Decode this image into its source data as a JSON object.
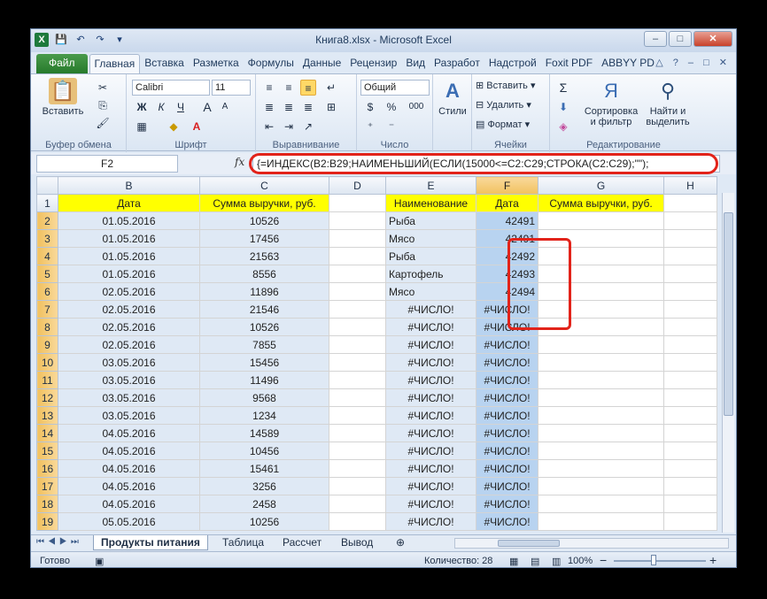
{
  "window": {
    "title": "Книга8.xlsx - Microsoft Excel",
    "min": "–",
    "max": "□",
    "close": "✕"
  },
  "qat": {
    "app_icon": "X",
    "save": "💾",
    "undo": "↶",
    "redo": "↷",
    "more": "▾"
  },
  "ribbon_tabs": [
    "Файл",
    "Главная",
    "Вставка",
    "Разметка",
    "Формулы",
    "Данные",
    "Рецензир",
    "Вид",
    "Разработ",
    "Надстрой",
    "Foxit PDF",
    "ABBYY PD"
  ],
  "ribbon": {
    "clipboard": {
      "paste": "Вставить",
      "label": "Буфер обмена"
    },
    "font": {
      "name": "Calibri",
      "size": "11",
      "bold": "Ж",
      "italic": "К",
      "underline": "Ч",
      "grow": "A",
      "shrink": "A",
      "label": "Шрифт"
    },
    "alignment": {
      "label": "Выравнивание"
    },
    "number": {
      "format": "Общий",
      "percent": "%",
      "thousands": "000",
      "label": "Число"
    },
    "styles": {
      "styles": "Стили"
    },
    "cells": {
      "insert": "Вставить",
      "delete": "Удалить",
      "format": "Формат",
      "label": "Ячейки"
    },
    "editing": {
      "sort": "Сортировка",
      "sort2": "и фильтр",
      "find": "Найти и",
      "find2": "выделить",
      "label": "Редактирование",
      "sigma": "Σ"
    }
  },
  "formula_bar": {
    "name_box": "F2",
    "fx": "fx",
    "formula": "{=ИНДЕКС(B2:B29;НАИМЕНЬШИЙ(ЕСЛИ(15000<=C2:C29;СТРОКА(C2:C29);\"\");"
  },
  "columns": [
    "B",
    "C",
    "D",
    "E",
    "F",
    "G",
    "H"
  ],
  "header_row": {
    "num": "1",
    "b": "Дата",
    "c": "Сумма выручки, руб.",
    "d": "",
    "e": "Наименование",
    "f": "Дата",
    "g": "Сумма выручки, руб."
  },
  "rows": [
    {
      "num": "2",
      "b": "01.05.2016",
      "c": "10526",
      "e": "Рыба",
      "f": "42491"
    },
    {
      "num": "3",
      "b": "01.05.2016",
      "c": "17456",
      "e": "Мясо",
      "f": "42491"
    },
    {
      "num": "4",
      "b": "01.05.2016",
      "c": "21563",
      "e": "Рыба",
      "f": "42492"
    },
    {
      "num": "5",
      "b": "01.05.2016",
      "c": "8556",
      "e": "Картофель",
      "f": "42493"
    },
    {
      "num": "6",
      "b": "02.05.2016",
      "c": "11896",
      "e": "Мясо",
      "f": "42494"
    },
    {
      "num": "7",
      "b": "02.05.2016",
      "c": "21546",
      "e": "#ЧИСЛО!",
      "f": "#ЧИСЛО!"
    },
    {
      "num": "8",
      "b": "02.05.2016",
      "c": "10526",
      "e": "#ЧИСЛО!",
      "f": "#ЧИСЛО!"
    },
    {
      "num": "9",
      "b": "02.05.2016",
      "c": "7855",
      "e": "#ЧИСЛО!",
      "f": "#ЧИСЛО!"
    },
    {
      "num": "10",
      "b": "03.05.2016",
      "c": "15456",
      "e": "#ЧИСЛО!",
      "f": "#ЧИСЛО!"
    },
    {
      "num": "11",
      "b": "03.05.2016",
      "c": "11496",
      "e": "#ЧИСЛО!",
      "f": "#ЧИСЛО!"
    },
    {
      "num": "12",
      "b": "03.05.2016",
      "c": "9568",
      "e": "#ЧИСЛО!",
      "f": "#ЧИСЛО!"
    },
    {
      "num": "13",
      "b": "03.05.2016",
      "c": "1234",
      "e": "#ЧИСЛО!",
      "f": "#ЧИСЛО!"
    },
    {
      "num": "14",
      "b": "04.05.2016",
      "c": "14589",
      "e": "#ЧИСЛО!",
      "f": "#ЧИСЛО!"
    },
    {
      "num": "15",
      "b": "04.05.2016",
      "c": "10456",
      "e": "#ЧИСЛО!",
      "f": "#ЧИСЛО!"
    },
    {
      "num": "16",
      "b": "04.05.2016",
      "c": "15461",
      "e": "#ЧИСЛО!",
      "f": "#ЧИСЛО!"
    },
    {
      "num": "17",
      "b": "04.05.2016",
      "c": "3256",
      "e": "#ЧИСЛО!",
      "f": "#ЧИСЛО!"
    },
    {
      "num": "18",
      "b": "04.05.2016",
      "c": "2458",
      "e": "#ЧИСЛО!",
      "f": "#ЧИСЛО!"
    },
    {
      "num": "19",
      "b": "05.05.2016",
      "c": "10256",
      "e": "#ЧИСЛО!",
      "f": "#ЧИСЛО!"
    }
  ],
  "sheet_tabs": [
    "Продукты питания",
    "Таблица",
    "Рассчет",
    "Вывод"
  ],
  "status": {
    "ready": "Готово",
    "count": "Количество: 28",
    "zoom": "100%",
    "minus": "−",
    "plus": "+"
  },
  "colors": {
    "highlight_yellow": "#ffff00",
    "selection_blue": "#b8d3f0",
    "annotation_red": "#e2231a"
  }
}
